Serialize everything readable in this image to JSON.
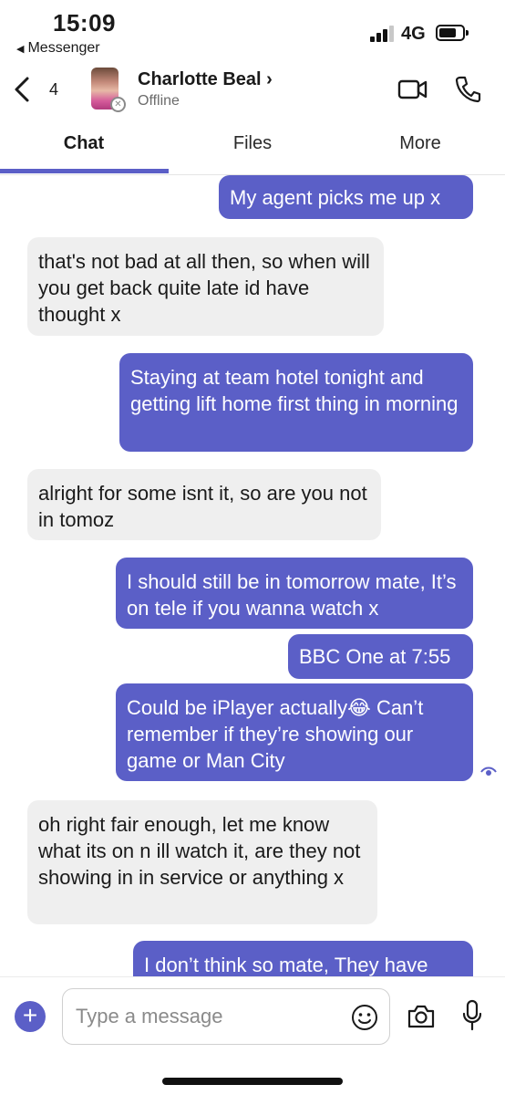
{
  "status_bar": {
    "time": "15:09",
    "back_app": "Messenger",
    "network": "4G"
  },
  "header": {
    "unread_count": "4",
    "contact_name": "Charlotte Beal",
    "contact_name_chevron": "›",
    "contact_status": "Offline",
    "icons": [
      "chevron-left-icon",
      "video-call-icon",
      "phone-call-icon",
      "offline-presence-icon"
    ]
  },
  "tabs": [
    {
      "label": "Chat",
      "active": true
    },
    {
      "label": "Files",
      "active": false
    },
    {
      "label": "More",
      "active": false
    }
  ],
  "messages": [
    {
      "direction": "out",
      "text": "My agent picks me up x"
    },
    {
      "direction": "in",
      "text": "that's not bad at all then, so when will you get back quite late id have thought x"
    },
    {
      "direction": "out",
      "text": "Staying at team hotel tonight and getting lift home first thing in morning"
    },
    {
      "direction": "in",
      "text": "alright for some isnt it, so are you not in tomoz"
    },
    {
      "direction": "out",
      "text": "I should still be in tomorrow mate, It’s on tele if you wanna watch x"
    },
    {
      "direction": "out",
      "text": "BBC One at 7:55"
    },
    {
      "direction": "out",
      "text": "Could be iPlayer actually😂 Can’t remember if they’re showing our game or Man City"
    },
    {
      "direction": "in",
      "text": "oh right fair enough, let me know what its on n ill watch it, are they not showing in in service or anything x"
    },
    {
      "direction": "out",
      "text": "I don’t think so mate, They have"
    }
  ],
  "composer": {
    "placeholder": "Type a message",
    "plus_label": "+",
    "icons": [
      "plus-icon",
      "emoji-icon",
      "camera-icon",
      "microphone-icon"
    ]
  },
  "colors": {
    "accent": "#5b5fc7",
    "incoming_bubble": "#efefef",
    "outgoing_text": "#ffffff"
  }
}
